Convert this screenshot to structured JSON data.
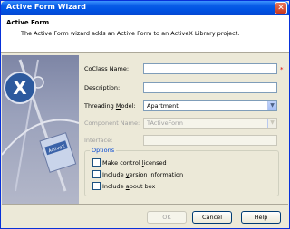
{
  "window": {
    "title": "Active Form Wizard",
    "close_glyph": "✕"
  },
  "header": {
    "title": "Active Form",
    "description": "The Active Form wizard adds an Active Form to an ActiveX Library project."
  },
  "side_image": {
    "badge_text": "ActiveX",
    "logo_letter": "X",
    "icon": "activex-logo-icon"
  },
  "form": {
    "coclass": {
      "label_u": "C",
      "label_rest": "oClass Name:",
      "value": ""
    },
    "description": {
      "label_u": "D",
      "label_rest": "escription:",
      "value": ""
    },
    "threading": {
      "label_pre": "Threading ",
      "label_u": "M",
      "label_rest": "odel:",
      "value": "Apartment"
    },
    "component": {
      "label": "Component Name:",
      "value": "TActiveForm"
    },
    "interface": {
      "label": "Interface:",
      "value": ""
    },
    "required_marker": "*"
  },
  "options": {
    "legend": "Options",
    "items": [
      {
        "pre": "Make control ",
        "u": "l",
        "post": "icensed",
        "checked": false
      },
      {
        "pre": "Include ",
        "u": "v",
        "post": "ersion information",
        "checked": false
      },
      {
        "pre": "Include ",
        "u": "a",
        "post": "bout box",
        "checked": false
      }
    ]
  },
  "buttons": {
    "ok": "OK",
    "cancel": "Cancel",
    "help": "Help"
  },
  "colors": {
    "title_bar": "#0054e3",
    "dialog_bg": "#ece9d8",
    "options_legend": "#0046d5",
    "required": "#e00000"
  }
}
